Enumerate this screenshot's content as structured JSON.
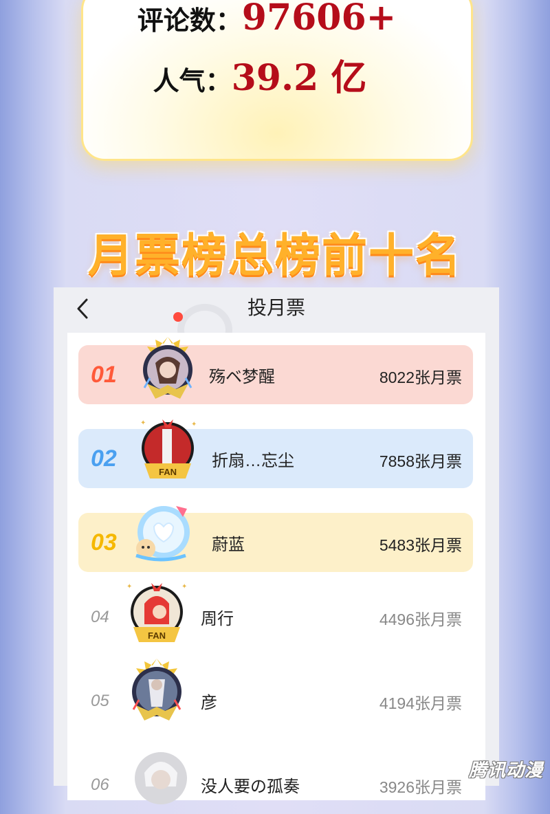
{
  "stats": {
    "comments_label": "评论数：",
    "comments_value": "97606+",
    "popularity_label": "人气：",
    "popularity_value": "39.2 亿"
  },
  "section_title": "月票榜总榜前十名",
  "header": {
    "title": "投月票"
  },
  "ranking": [
    {
      "rank": "01",
      "name": "殇ベ梦醒",
      "votes": "8022张月票",
      "color": "#ff5a3a",
      "bg": "#fbd9d3"
    },
    {
      "rank": "02",
      "name": "折扇…忘尘",
      "votes": "7858张月票",
      "color": "#4aa0f0",
      "bg": "#dbeafb"
    },
    {
      "rank": "03",
      "name": "蔚蓝",
      "votes": "5483张月票",
      "color": "#f5b800",
      "bg": "#fdf0c9"
    },
    {
      "rank": "04",
      "name": "周行",
      "votes": "4496张月票"
    },
    {
      "rank": "05",
      "name": "彦",
      "votes": "4194张月票"
    },
    {
      "rank": "06",
      "name": "没人要の孤奏",
      "votes": "3926张月票"
    }
  ],
  "watermark": "腾讯动漫"
}
